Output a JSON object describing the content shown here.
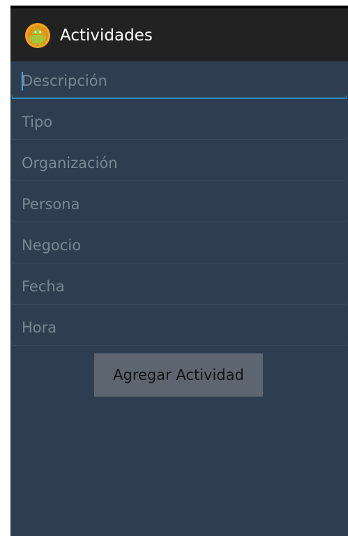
{
  "action_bar": {
    "title": "Actividades",
    "drawer_icon": "menu-icon",
    "app_icon": "android-icon"
  },
  "form": {
    "fields": [
      {
        "placeholder": "Descripción",
        "focused": true
      },
      {
        "placeholder": "Tipo"
      },
      {
        "placeholder": "Organización"
      },
      {
        "placeholder": "Persona"
      },
      {
        "placeholder": "Negocio"
      },
      {
        "placeholder": "Fecha"
      },
      {
        "placeholder": "Hora"
      }
    ],
    "submit_label": "Agregar Actividad"
  },
  "colors": {
    "background": "#2e3d4f",
    "action_bar": "#222222",
    "focus_accent": "#2f8fbf",
    "button": "#5d6670",
    "hint_text": "#7b8795"
  }
}
